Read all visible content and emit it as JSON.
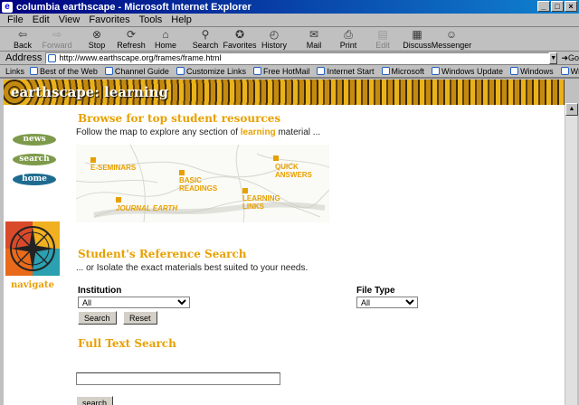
{
  "window": {
    "title": "columbia earthscape - Microsoft Internet Explorer"
  },
  "menu": [
    "File",
    "Edit",
    "View",
    "Favorites",
    "Tools",
    "Help"
  ],
  "toolbar": [
    {
      "label": "Back",
      "icon": "back-arrow-icon",
      "glyph": "⇦",
      "enabled": true
    },
    {
      "label": "Forward",
      "icon": "forward-arrow-icon",
      "glyph": "⇨",
      "enabled": false
    },
    {
      "label": "Stop",
      "icon": "stop-icon",
      "glyph": "⊗",
      "enabled": true
    },
    {
      "label": "Refresh",
      "icon": "refresh-icon",
      "glyph": "⟳",
      "enabled": true
    },
    {
      "label": "Home",
      "icon": "home-icon",
      "glyph": "⌂",
      "enabled": true
    },
    {
      "label": "Search",
      "icon": "search-icon",
      "glyph": "⚲",
      "enabled": true
    },
    {
      "label": "Favorites",
      "icon": "favorites-icon",
      "glyph": "✪",
      "enabled": true
    },
    {
      "label": "History",
      "icon": "history-icon",
      "glyph": "◴",
      "enabled": true
    },
    {
      "label": "Mail",
      "icon": "mail-icon",
      "glyph": "✉",
      "enabled": true
    },
    {
      "label": "Print",
      "icon": "print-icon",
      "glyph": "⎙",
      "enabled": true
    },
    {
      "label": "Edit",
      "icon": "edit-icon",
      "glyph": "▤",
      "enabled": false
    },
    {
      "label": "Discuss",
      "icon": "discuss-icon",
      "glyph": "▦",
      "enabled": true
    },
    {
      "label": "Messenger",
      "icon": "messenger-icon",
      "glyph": "☺",
      "enabled": true
    }
  ],
  "address": {
    "label": "Address",
    "url": "http://www.earthscape.org/frames/frame.html",
    "go_label": "Go"
  },
  "links": {
    "label": "Links",
    "items": [
      "Best of the Web",
      "Channel Guide",
      "Customize Links",
      "Free HotMail",
      "Internet Start",
      "Microsoft",
      "Windows Update",
      "Windows",
      "Windows Media"
    ]
  },
  "page": {
    "banner_title": "earthscape: learning",
    "nav": {
      "news": "news",
      "search": "search",
      "home": "home",
      "navigate": "navigate"
    },
    "browse": {
      "heading": "Browse for top student resources",
      "text_before": "Follow the map to explore any section of ",
      "highlight": "learning",
      "text_after": " material ..."
    },
    "map_labels": {
      "eseminars": "E-SEMINARS",
      "basic": "BASIC READINGS",
      "quick": "QUICK ANSWERS",
      "journal": "JOURNAL EARTH",
      "learning": "LEARNING LINKS"
    },
    "reference": {
      "heading": "Student's Reference Search",
      "text": "... or Isolate the exact materials best suited to your needs."
    },
    "institution": {
      "label": "Institution",
      "value": "All"
    },
    "filetype": {
      "label": "File Type",
      "value": "All"
    },
    "buttons": {
      "search": "Search",
      "reset": "Reset",
      "search2": "search"
    },
    "fulltext": {
      "heading": "Full Text Search",
      "value": ""
    }
  },
  "colors": {
    "accent": "#e8a000",
    "nav_green": "#6b8e3a",
    "nav_blue": "#1e6b8f",
    "title_bar": "#000080"
  }
}
